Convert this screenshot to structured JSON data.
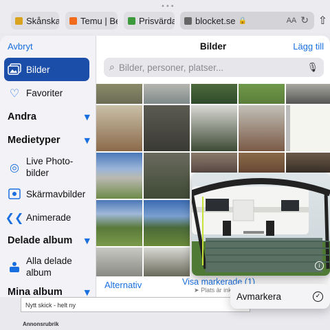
{
  "browser": {
    "tabs": [
      {
        "label": "Skånska D",
        "fav_color": "#d9a320"
      },
      {
        "label": "Temu | Be",
        "fav_color": "#f26b1d"
      },
      {
        "label": "Prisvärda",
        "fav_color": "#3c9a3c"
      }
    ],
    "address": "blocket.se",
    "aa_label": "AA"
  },
  "sidebar": {
    "cancel": "Avbryt",
    "items": [
      {
        "label": "Bilder"
      },
      {
        "label": "Favoriter"
      },
      {
        "label": "Live Photo-bilder"
      },
      {
        "label": "Skärmavbilder"
      },
      {
        "label": "Animerade"
      },
      {
        "label": "Alla delade album"
      }
    ],
    "sections": [
      "Andra",
      "Medietyper",
      "Delade album",
      "Mina album"
    ]
  },
  "main": {
    "title": "Bilder",
    "add": "Lägg till",
    "search_placeholder": "Bilder, personer, platser...",
    "alternatives": "Alternativ",
    "show_selected": "Visa markerade (1)",
    "place_note": "Plats är inklu"
  },
  "context_menu": {
    "deselect": "Avmarkera"
  },
  "page": {
    "condition_value": "Nytt skick - helt ny",
    "ad_title_label": "Annonsrubrik"
  },
  "colors": {
    "accent": "#1a6fe0",
    "selected_bg": "#1a4ea8"
  }
}
